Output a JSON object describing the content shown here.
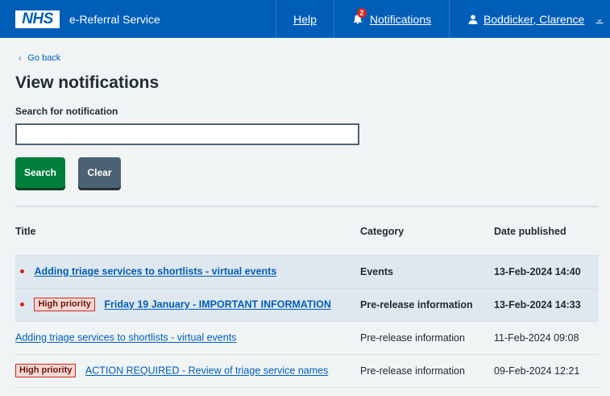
{
  "header": {
    "logo_text": "NHS",
    "service_name": "e-Referral Service",
    "nav": {
      "help": "Help",
      "notifications": "Notifications",
      "notifications_count": "2",
      "user": "Boddicker, Clarence"
    }
  },
  "colors": {
    "header_blue": "#005eb8",
    "search_button": "#007f3b",
    "clear_button": "#4c6272",
    "unread_row": "#dfe8f0",
    "priority_red": "#d5281b"
  },
  "page": {
    "back_link": "Go back",
    "title": "View notifications",
    "search_label": "Search for notification",
    "search_value": "",
    "search_button": "Search",
    "clear_button": "Clear"
  },
  "table": {
    "headers": {
      "title": "Title",
      "category": "Category",
      "date": "Date published"
    },
    "rows": [
      {
        "unread": true,
        "priority": "",
        "title": "Adding triage services to shortlists - virtual events",
        "category": "Events",
        "date": "13-Feb-2024 14:40"
      },
      {
        "unread": true,
        "priority": "High priority",
        "title": "Friday 19 January - IMPORTANT INFORMATION",
        "category": "Pre-release information",
        "date": "13-Feb-2024 14:33"
      },
      {
        "unread": false,
        "priority": "",
        "title": "Adding triage services to shortlists - virtual events",
        "category": "Pre-release information",
        "date": "11-Feb-2024 09:08"
      },
      {
        "unread": false,
        "priority": "High priority",
        "title": "ACTION REQUIRED - Review of triage service names",
        "category": "Pre-release information",
        "date": "09-Feb-2024 12:21"
      }
    ]
  }
}
